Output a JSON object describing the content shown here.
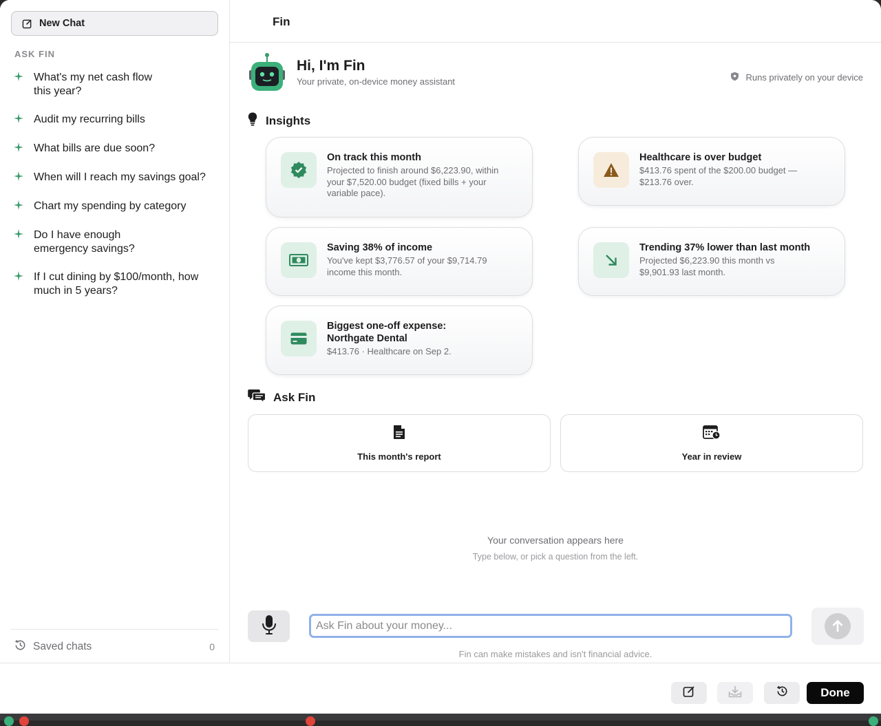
{
  "sidebar": {
    "new_chat_label": "New Chat",
    "section_label": "ASK FIN",
    "questions": [
      "What's my net cash flow this year?",
      "Audit my recurring bills",
      "What bills are due soon?",
      "When will I reach my savings goal?",
      "Chart my spending by category",
      "Do I have enough emergency savings?",
      "If I cut dining by $100/month, how much in 5 years?"
    ],
    "saved_label": "Saved chats",
    "saved_count": "0"
  },
  "header": {
    "title": "Fin"
  },
  "hero": {
    "greeting": "Hi, I'm Fin",
    "subtitle": "Your private, on-device money assistant",
    "privacy": "Runs privately on your device"
  },
  "insights": {
    "heading": "Insights",
    "cards": [
      {
        "title": "On track this month",
        "desc": "Projected to finish around $6,223.90, within your $7,520.00 budget (fixed bills + your variable pace).",
        "icon": "verified-check-icon"
      },
      {
        "title": "Healthcare is over budget",
        "desc": "$413.76 spent of the $200.00 budget — $213.76 over.",
        "icon": "warning-icon"
      },
      {
        "title": "Saving 38% of income",
        "desc": "You've kept $3,776.57 of your $9,714.79 income this month.",
        "icon": "banknote-icon"
      },
      {
        "title": "Trending 37% lower than last month",
        "desc": "Projected $6,223.90 this month vs $9,901.93 last month.",
        "icon": "trend-down-arrow-icon"
      },
      {
        "title": "Biggest one-off expense: Northgate Dental",
        "desc": "$413.76 · Healthcare on Sep 2.",
        "icon": "credit-card-icon"
      }
    ]
  },
  "ask": {
    "heading": "Ask Fin",
    "buttons": [
      "This month's report",
      "Year in review"
    ]
  },
  "conversation": {
    "empty_title": "Your conversation appears here",
    "empty_hint": "Type below, or pick a question from the left."
  },
  "composer": {
    "placeholder": "Ask Fin about your money...",
    "disclaimer": "Fin can make mistakes and isn't financial advice."
  },
  "bottombar": {
    "done_label": "Done"
  },
  "colors": {
    "accent_green": "#3a9a6a",
    "icon_bg_green": "#dff0e7",
    "warn_bg": "#f7ecdc",
    "warn_fg": "#8a5a1c",
    "focus_ring": "#8fb1ea"
  }
}
